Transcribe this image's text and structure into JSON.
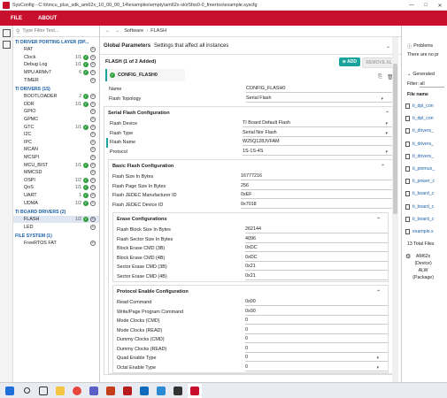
{
  "window": {
    "title": "SysConfig - C:\\ti\\mcu_plus_sdk_am62x_10_00_00_14\\examples\\empty\\am62x-sk\\r5fss0-0_freertos\\example.syscfg",
    "controls": [
      "—",
      "□",
      "✕"
    ]
  },
  "menu": {
    "file": "FILE",
    "about": "ABOUT"
  },
  "left": {
    "filter_placeholder": "Type Filter Text...",
    "groups": [
      {
        "title": "TI DRIVER PORTING LAYER (DP...",
        "items": [
          {
            "label": "RAT",
            "count": "",
            "added": false
          },
          {
            "label": "Clock",
            "count": "1/1",
            "added": true
          },
          {
            "label": "Debug Log",
            "count": "1/1",
            "added": true
          },
          {
            "label": "MPU ARMv7",
            "count": "6",
            "added": true
          },
          {
            "label": "TIMER",
            "count": "",
            "added": false
          }
        ]
      },
      {
        "title": "TI DRIVERS (15)",
        "items": [
          {
            "label": "BOOTLOADER",
            "count": "2",
            "added": true
          },
          {
            "label": "DDR",
            "count": "1/1",
            "added": true
          },
          {
            "label": "GPIO",
            "count": "",
            "added": false
          },
          {
            "label": "GPMC",
            "count": "",
            "added": false
          },
          {
            "label": "GTC",
            "count": "1/1",
            "added": true
          },
          {
            "label": "I2C",
            "count": "",
            "added": false
          },
          {
            "label": "IPC",
            "count": "",
            "added": false
          },
          {
            "label": "MCAN",
            "count": "",
            "added": false
          },
          {
            "label": "MCSPI",
            "count": "",
            "added": false
          },
          {
            "label": "MCU_BIST",
            "count": "1/1",
            "added": true
          },
          {
            "label": "MMCSD",
            "count": "",
            "added": false
          },
          {
            "label": "OSPI",
            "count": "1/2",
            "added": true
          },
          {
            "label": "QoS",
            "count": "1/1",
            "added": true
          },
          {
            "label": "UART",
            "count": "1",
            "added": true
          },
          {
            "label": "UDMA",
            "count": "1/2",
            "added": true
          }
        ]
      },
      {
        "title": "TI BOARD DRIVERS (2)",
        "items": [
          {
            "label": "FLASH",
            "count": "1/2",
            "added": true,
            "selected": true
          },
          {
            "label": "LED",
            "count": "",
            "added": false
          }
        ]
      },
      {
        "title": "FILE SYSTEM (1)",
        "items": [
          {
            "label": "FreeRTOS FAT",
            "count": "",
            "added": false
          }
        ]
      }
    ]
  },
  "nav": {
    "breadcrumb_a": "Software",
    "sep": "›",
    "breadcrumb_b": "FLASH"
  },
  "global": {
    "title": "Global Parameters",
    "subtitle": "Settings that affect all instances"
  },
  "flash": {
    "header": "FLASH (1 of 2 Added)",
    "add": "ADD",
    "remove": "REMOVE ALL",
    "instance": "CONFIG_FLASH0",
    "name_label": "Name",
    "name_value": "CONFIG_FLASH0",
    "topology_label": "Flash Topology",
    "topology_value": "Serial Flash",
    "serial_title": "Serial Flash Configuration",
    "device_label": "Flash Device",
    "device_value": "TI Board Default Flash",
    "type_label": "Flash Type",
    "type_value": "Serial Nor Flash",
    "fname_label": "Flash Name",
    "fname_value": "W25Q128JVFAM",
    "protocol_label": "Protocol",
    "protocol_value": "1S-1S-4S",
    "basic_title": "Basic Flash Configuration",
    "basic": [
      {
        "k": "Flash Size In Bytes",
        "v": "16777216"
      },
      {
        "k": "Flash Page Size In Bytes",
        "v": "256"
      },
      {
        "k": "Flash JEDEC Manufacturer ID",
        "v": "0xEF"
      },
      {
        "k": "Flash JEDEC Device ID",
        "v": "0x7018"
      }
    ],
    "erase_title": "Erase Configurations",
    "erase": [
      {
        "k": "Flash Block Size In Bytes",
        "v": "262144"
      },
      {
        "k": "Flash Sector Size In Bytes",
        "v": "4096"
      },
      {
        "k": "Block Erase CMD (3B)",
        "v": "0xDC"
      },
      {
        "k": "Block Erase CMD (4B)",
        "v": "0xDC"
      },
      {
        "k": "Sector Erase CMD (3B)",
        "v": "0x21"
      },
      {
        "k": "Sector Erase CMD (4B)",
        "v": "0x21"
      }
    ],
    "proto_title": "Protocol Enable Configuration",
    "proto": [
      {
        "k": "Read Command",
        "v": "0x00"
      },
      {
        "k": "Write/Page Program Command",
        "v": "0x00"
      },
      {
        "k": "Mode Clocks (CMD)",
        "v": "0"
      },
      {
        "k": "Mode Clocks (READ)",
        "v": "0"
      },
      {
        "k": "Dummy Clocks (CMD)",
        "v": "0"
      },
      {
        "k": "Dummy Clocks (READ)",
        "v": "0"
      },
      {
        "k": "Quad Enable Type",
        "v": "0"
      },
      {
        "k": "Octal Enable Type",
        "v": "0"
      }
    ]
  },
  "right": {
    "problems": "Problems",
    "problems_text": "There are no pr",
    "generated": "Generated",
    "filter_label": "Filter:",
    "filter_value": "all",
    "filename_header": "File name",
    "files": [
      "ti_dpl_con",
      "ti_dpl_con",
      "ti_drivers_",
      "ti_drivers_",
      "ti_drivers_",
      "ti_pinmux_",
      "ti_power_c",
      "ti_board_c",
      "ti_board_c",
      "ti_board_c",
      "example.s"
    ],
    "total": "13 Total Files",
    "device": [
      "AM62x",
      "(Device)",
      "ALW",
      "(Package)"
    ]
  }
}
